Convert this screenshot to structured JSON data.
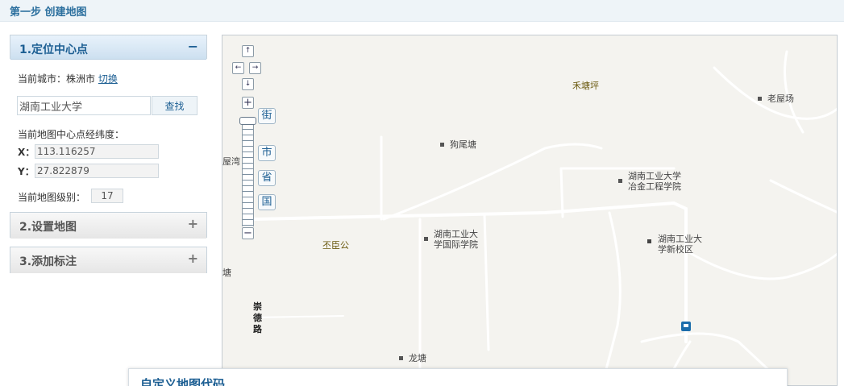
{
  "header": {
    "title": "第一步 创建地图"
  },
  "accordion": [
    {
      "label": "1.定位中心点",
      "sign": "−",
      "active": true
    },
    {
      "label": "2.设置地图",
      "sign": "+"
    },
    {
      "label": "3.添加标注",
      "sign": "+"
    }
  ],
  "locate": {
    "city_label": "当前城市：",
    "city_value": "株洲市",
    "switch_link": "切换",
    "search_value": "湖南工业大学",
    "search_button": "查找",
    "center_label": "当前地图中心点经纬度：",
    "x_label": "X：",
    "x_value": "113.116257",
    "y_label": "Y：",
    "y_value": "27.822879",
    "level_label": "当前地图级别：",
    "level_value": "17"
  },
  "map": {
    "nav": {
      "up": "↑",
      "left": "←",
      "right": "→",
      "down": "↓",
      "zoom_in": "+",
      "zoom_out": "−"
    },
    "levels": [
      "街",
      "市",
      "省",
      "国"
    ],
    "labels": {
      "hetangping": "禾塘坪",
      "laowuchang": "老屋场",
      "gouweitang": "狗尾塘",
      "yejin_line1": "湖南工业大学",
      "yejin_line2": "冶金工程学院",
      "guoji_line1": "湖南工业大",
      "guoji_line2": "学国际学院",
      "xinxiaoqu_line1": "湖南工业大",
      "xinxiaoqu_line2": "学新校区",
      "pichengong": "丕臣公",
      "longtang": "龙塘",
      "wuwan": "屋湾",
      "tang": "塘",
      "chongde_1": "崇",
      "chongde_2": "德",
      "chongde_3": "路"
    }
  },
  "code_panel": {
    "label": "自定义地图代码"
  },
  "colors": {
    "accent": "#1d5f93",
    "header_bg": "#eef4f8",
    "map_bg": "#f4f3ef",
    "road": "#ffffff"
  }
}
